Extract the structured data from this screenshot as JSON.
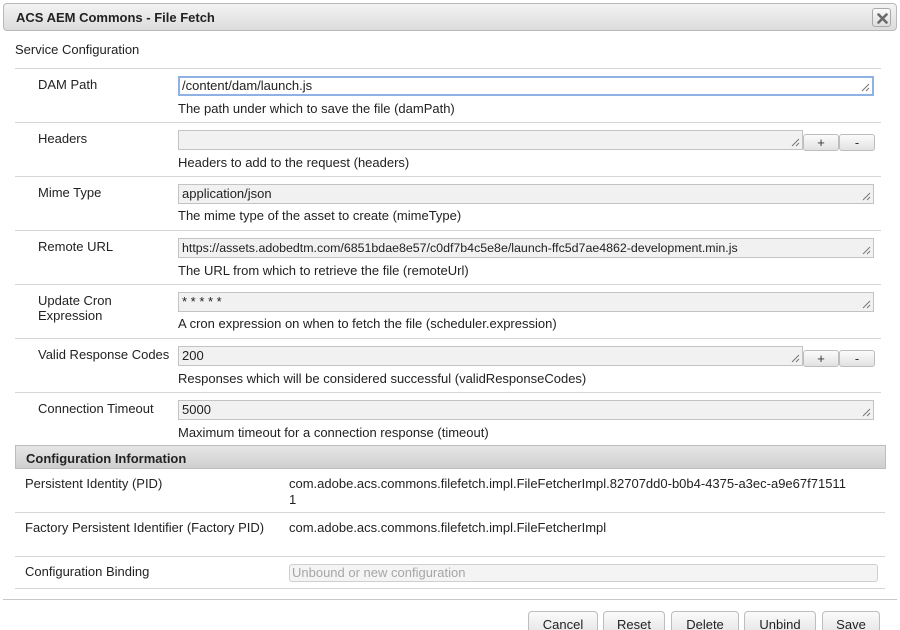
{
  "window": {
    "title": "ACS AEM Commons - File Fetch"
  },
  "service_configuration_label": "Service Configuration",
  "properties": [
    {
      "label": "DAM Path",
      "value": "/content/dam/launch.js",
      "description": "The path under which to save the file (damPath)"
    },
    {
      "label": "Headers",
      "value": "",
      "description": "Headers to add to the request (headers)",
      "add_label": "+",
      "remove_label": "-"
    },
    {
      "label": "Mime Type",
      "value": "application/json",
      "description": "The mime type of the asset to create (mimeType)"
    },
    {
      "label": "Remote URL",
      "value": "https://assets.adobedtm.com/6851bdae8e57/c0df7b4c5e8e/launch-ffc5d7ae4862-development.min.js",
      "description": "The URL from which to retrieve the file (remoteUrl)"
    },
    {
      "label": "Update Cron Expression",
      "value": "* * * * *",
      "description": "A cron expression on when to fetch the file (scheduler.expression)"
    },
    {
      "label": "Valid Response Codes",
      "value": "200",
      "description": "Responses which will be considered successful (validResponseCodes)",
      "add_label": "+",
      "remove_label": "-"
    },
    {
      "label": "Connection Timeout",
      "value": "5000",
      "description": "Maximum timeout for a connection response (timeout)"
    }
  ],
  "configuration_information": {
    "heading": "Configuration Information",
    "rows": [
      {
        "label": "Persistent Identity (PID)",
        "value": "com.adobe.acs.commons.filefetch.impl.FileFetcherImpl.82707dd0-b0b4-4375-a3ec-a9e67f715111"
      },
      {
        "label": "Factory Persistent Identifier (Factory PID)",
        "value": "com.adobe.acs.commons.filefetch.impl.FileFetcherImpl"
      },
      {
        "label": "Configuration Binding",
        "placeholder": "Unbound or new configuration"
      }
    ]
  },
  "footer_buttons": {
    "cancel": "Cancel",
    "reset": "Reset",
    "delete": "Delete",
    "unbind": "Unbind",
    "save": "Save"
  },
  "icons": {
    "close": "close-icon",
    "resize": "resize-grip-icon"
  }
}
